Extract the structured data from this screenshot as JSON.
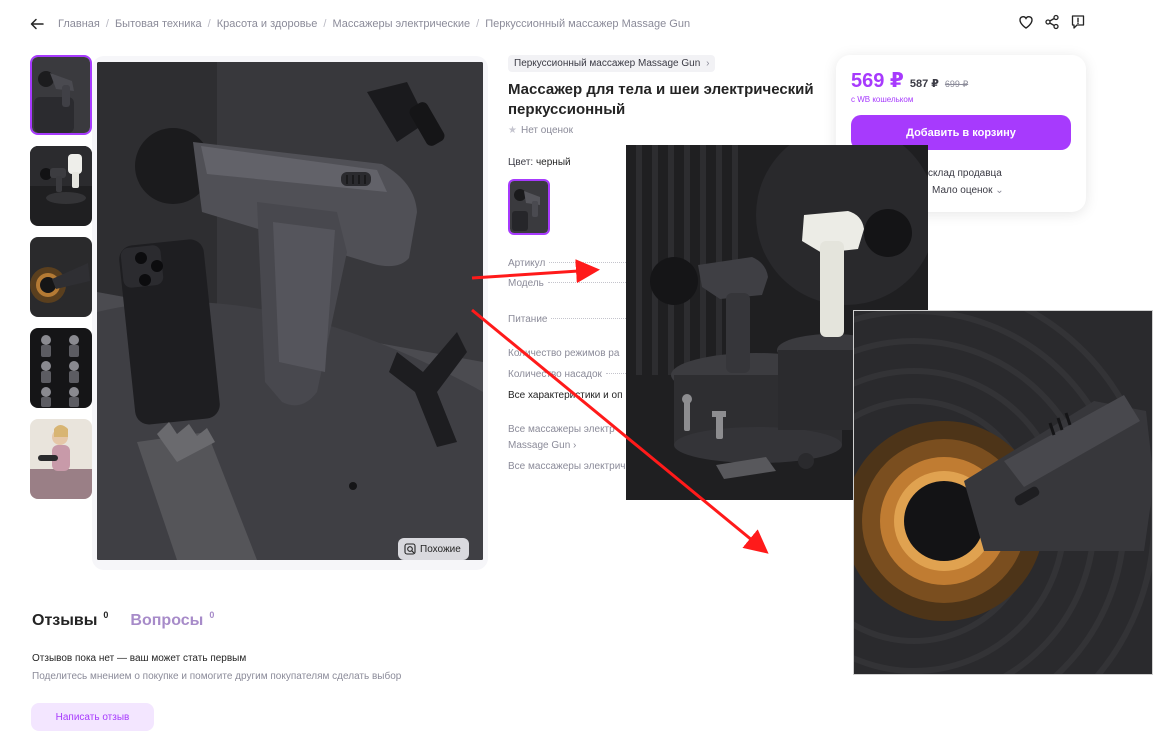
{
  "breadcrumb": {
    "items": [
      "Главная",
      "Бытовая техника",
      "Красота и здоровье",
      "Массажеры электрические",
      "Перкуссионный массажер Massage Gun"
    ],
    "separator": "/"
  },
  "gallery": {
    "similar_label": "Похожие",
    "thumb_count": 5
  },
  "product": {
    "brand_tag": "Перкуссионный массажер Massage Gun",
    "title": "Массажер для тела и шеи электрический перкуссионный",
    "rating_text": "Нет оценок",
    "color_label": "Цвет:",
    "color_value": "черный"
  },
  "specs": {
    "rows": [
      "Артикул",
      "Модель",
      "Питание",
      "Количество режимов ра",
      "Количество насадок"
    ],
    "all_characteristics": "Все характеристики и оп",
    "link1_line1": "Все массажеры электр",
    "link1_line2": "Massage Gun",
    "link2": "Все массажеры электрич"
  },
  "price_card": {
    "price": "569 ₽",
    "old_price": "587 ₽",
    "strike_price": "699 ₽",
    "wallet_note": "с WB кошельком",
    "cart_button": "Добавить в корзину",
    "seller_note": "склад продавца",
    "reviews_note": "Мало оценок"
  },
  "reviews": {
    "tab_reviews": "Отзывы",
    "tab_reviews_count": "0",
    "tab_questions": "Вопросы",
    "tab_questions_count": "0",
    "empty_title": "Отзывов пока нет — ваш может стать первым",
    "empty_sub": "Поделитесь мнением о покупке и помогите другим покупателям сделать выбор",
    "write_button": "Написать отзыв"
  },
  "colors": {
    "accent": "#a73afd",
    "arrow": "#ff1a1a"
  },
  "icons": [
    "back-arrow-icon",
    "heart-icon",
    "share-icon",
    "report-icon",
    "similar-search-icon",
    "star-icon",
    "chevron-right-icon",
    "chevron-down-icon"
  ]
}
